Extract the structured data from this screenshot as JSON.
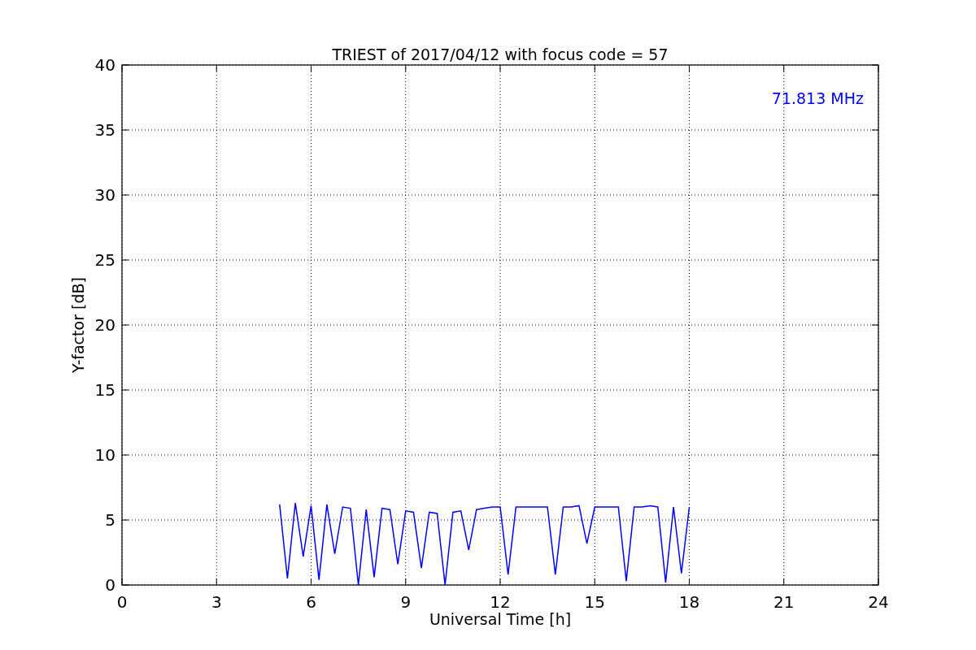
{
  "chart_data": {
    "type": "line",
    "title": "TRIEST of 2017/04/12 with focus code = 57",
    "xlabel": "Universal Time [h]",
    "ylabel": "Y-factor [dB]",
    "x": [
      5.0,
      5.25,
      5.5,
      5.75,
      6.0,
      6.25,
      6.5,
      6.75,
      7.0,
      7.25,
      7.5,
      7.75,
      8.0,
      8.25,
      8.5,
      8.75,
      9.0,
      9.25,
      9.5,
      9.75,
      10.0,
      10.25,
      10.5,
      10.75,
      11.0,
      11.25,
      11.5,
      11.75,
      12.0,
      12.25,
      12.5,
      12.75,
      13.0,
      13.25,
      13.5,
      13.75,
      14.0,
      14.25,
      14.5,
      14.75,
      15.0,
      15.25,
      15.5,
      15.75,
      16.0,
      16.25,
      16.5,
      16.75,
      17.0,
      17.25,
      17.5,
      17.75,
      18.0
    ],
    "series": [
      {
        "name": "71.813 MHz",
        "color": "#0000ff",
        "values": [
          6.2,
          0.5,
          6.3,
          2.2,
          6.1,
          0.4,
          6.2,
          2.4,
          6.0,
          5.9,
          0.0,
          5.8,
          0.6,
          5.9,
          5.8,
          1.6,
          5.7,
          5.6,
          1.3,
          5.6,
          5.5,
          0.0,
          5.6,
          5.7,
          2.7,
          5.8,
          5.9,
          6.0,
          6.0,
          0.8,
          6.0,
          6.0,
          6.0,
          6.0,
          6.0,
          0.8,
          6.0,
          6.0,
          6.1,
          3.2,
          6.0,
          6.0,
          6.0,
          6.0,
          0.3,
          6.0,
          6.0,
          6.1,
          6.0,
          0.2,
          6.0,
          0.9,
          6.0
        ]
      }
    ],
    "xlim": [
      0,
      24
    ],
    "ylim": [
      0,
      40
    ],
    "xticks": [
      0,
      3,
      6,
      9,
      12,
      15,
      18,
      21,
      24
    ],
    "yticks": [
      0,
      5,
      10,
      15,
      20,
      25,
      30,
      35,
      40
    ],
    "grid": true
  }
}
